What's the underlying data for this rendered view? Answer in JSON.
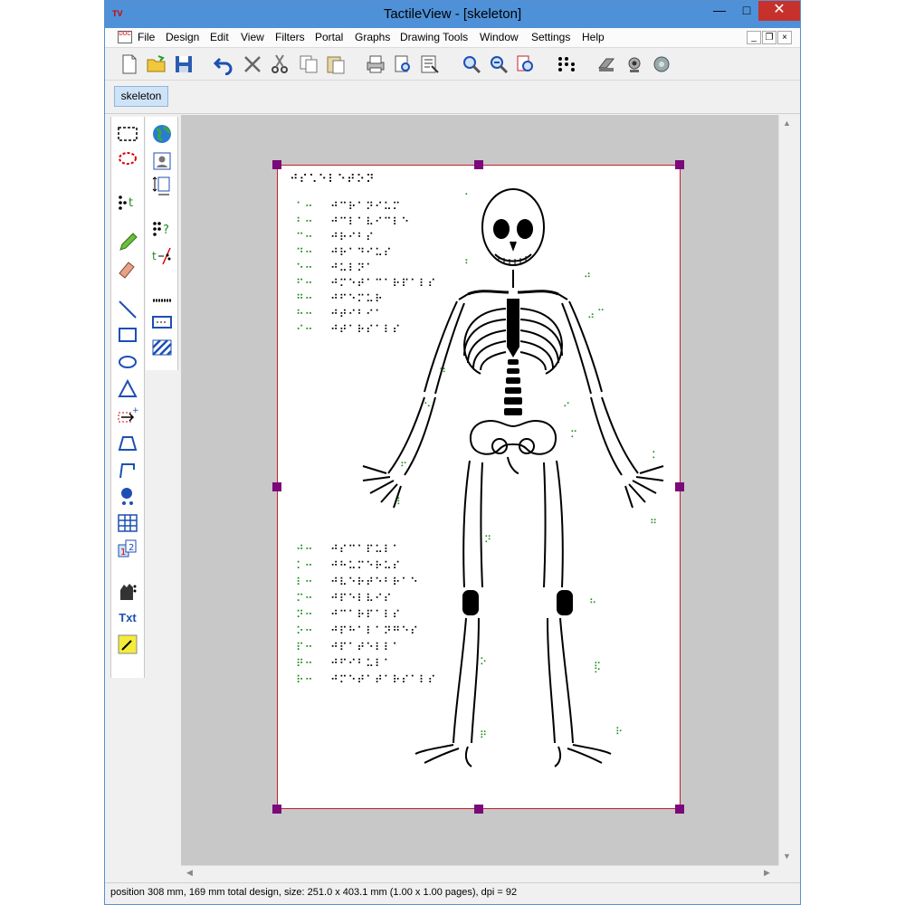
{
  "window": {
    "title": "TactileView - [skeleton]",
    "app_badge": "TV",
    "minimize": "—",
    "maximize": "□",
    "close": "✕"
  },
  "menu": {
    "items": [
      "File",
      "Design",
      "Edit",
      "View",
      "Filters",
      "Portal",
      "Graphs",
      "Drawing Tools",
      "Window",
      "Settings",
      "Help"
    ],
    "mdi_minimize": "_",
    "mdi_restore": "❐",
    "mdi_close": "×"
  },
  "tabs": [
    {
      "label": "skeleton"
    }
  ],
  "status": {
    "text": "position 308 mm, 169 mm total design, size: 251.0 x 403.1 mm (1.00 x 1.00 pages), dpi = 92"
  },
  "tools": {
    "txt_label": "Txt"
  },
  "braille_title": "⠚⠎⠡⠑⠇⠑⠞⠕⠝",
  "legend_top": [
    {
      "key": "⠁⠒",
      "value": "⠚⠉⠗⠁⠝⠊⠥⠍"
    },
    {
      "key": "⠃⠒",
      "value": "⠚⠉⠇⠁⠧⠊⠉⠇⠑"
    },
    {
      "key": "⠉⠒",
      "value": "⠚⠗⠊⠃⠎"
    },
    {
      "key": "⠙⠒",
      "value": "⠚⠗⠁⠙⠊⠥⠎"
    },
    {
      "key": "⠑⠒",
      "value": "⠚⠥⠇⠝⠁"
    },
    {
      "key": "⠋⠒",
      "value": "⠚⠍⠑⠞⠁⠉⠁⠗⠏⠁⠇⠎"
    },
    {
      "key": "⠛⠒",
      "value": "⠚⠋⠑⠍⠥⠗"
    },
    {
      "key": "⠓⠒",
      "value": "⠚⠞⠊⠃⠊⠁"
    },
    {
      "key": "⠊⠒",
      "value": "⠚⠞⠁⠗⠎⠁⠇⠎"
    }
  ],
  "legend_bottom": [
    {
      "key": "⠚⠒",
      "value": "⠚⠎⠉⠁⠏⠥⠇⠁"
    },
    {
      "key": "⠅⠒",
      "value": "⠚⠓⠥⠍⠑⠗⠥⠎"
    },
    {
      "key": "⠇⠒",
      "value": "⠚⠧⠑⠗⠞⠑⠃⠗⠁⠑"
    },
    {
      "key": "⠍⠒",
      "value": "⠚⠏⠑⠇⠧⠊⠎"
    },
    {
      "key": "⠝⠒",
      "value": "⠚⠉⠁⠗⠏⠁⠇⠎"
    },
    {
      "key": "⠕⠒",
      "value": "⠚⠏⠓⠁⠇⠁⠝⠛⠑⠎"
    },
    {
      "key": "⠏⠒",
      "value": "⠚⠏⠁⠞⠑⠇⠇⠁"
    },
    {
      "key": "⠟⠒",
      "value": "⠚⠋⠊⠃⠥⠇⠁"
    },
    {
      "key": "⠗⠒",
      "value": "⠚⠍⠑⠞⠁⠞⠁⠗⠎⠁⠇⠎"
    }
  ],
  "markers": [
    "⠁",
    "⠃",
    "⠚",
    "⠉",
    "⠙",
    "⠑",
    "⠊",
    "⠍",
    "⠅",
    "⠋",
    "⠇",
    "⠛",
    "⠝",
    "⠓",
    "⠕",
    "⠏",
    "⠟",
    "⠗",
    "⠊",
    "⠚"
  ]
}
